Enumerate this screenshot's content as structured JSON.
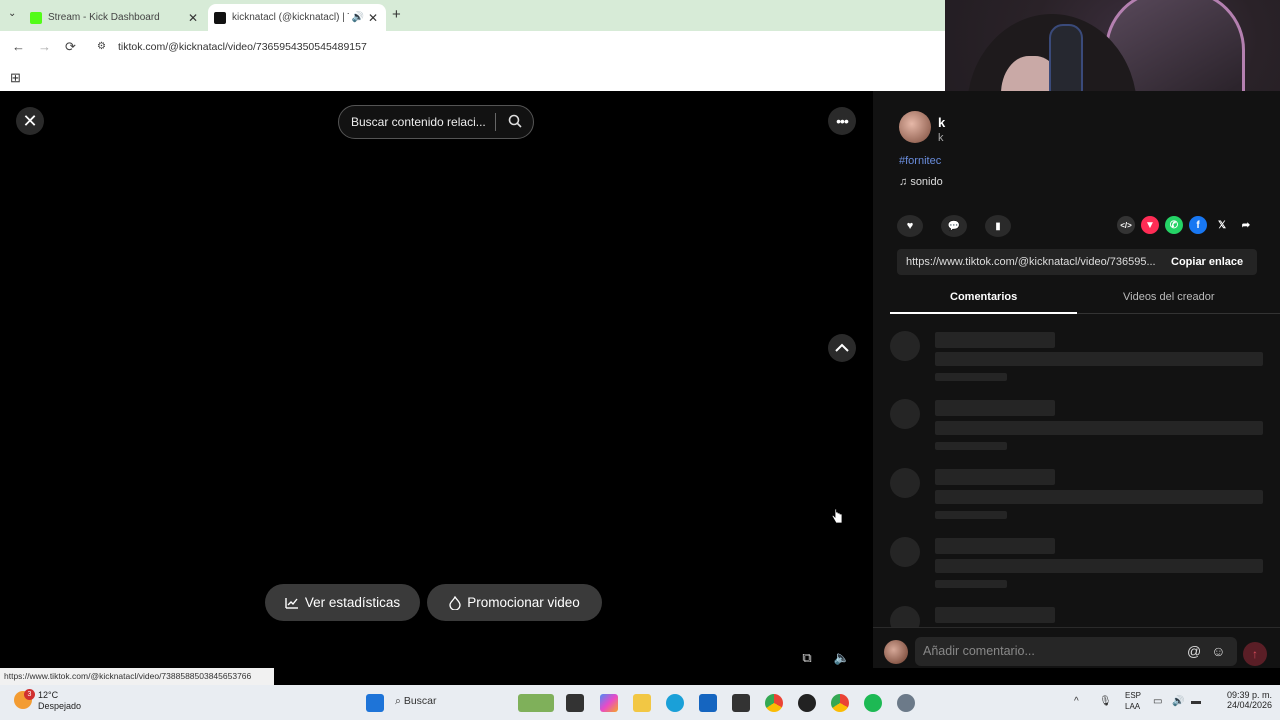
{
  "browser": {
    "tabs": [
      {
        "title": "Stream - Kick Dashboard",
        "favicon_color": "#53fc18"
      },
      {
        "title": "kicknatacl (@kicknatacl) | Ti",
        "favicon_color": "#111111"
      }
    ],
    "url": "tiktok.com/@kicknatacl/video/7365954350545489157"
  },
  "video": {
    "search_placeholder": "Buscar contenido relaci...",
    "stats_button": "Ver estadísticas",
    "promote_button": "Promocionar video",
    "hover_url": "https://www.tiktok.com/@kicknatacl/video/7388588503845653766"
  },
  "panel": {
    "name": "k",
    "username": "k",
    "hashtag": "#fornitec",
    "sound": "sonido",
    "share_link": "https://www.tiktok.com/@kicknatacl/video/736595...",
    "copy_button": "Copiar enlace",
    "tabs": [
      "Comentarios",
      "Videos del creador"
    ],
    "comment_placeholder": "Añadir comentario..."
  },
  "taskbar": {
    "weather_temp": "12°C",
    "weather_desc": "Despejado",
    "weather_badge": "3",
    "search_label": "Buscar",
    "lang_top": "ESP",
    "lang_bottom": "LAA",
    "time": "09:39 p. m.",
    "date": "24/04/2026"
  },
  "colors": {
    "tiktok_red": "#fe2c55",
    "panel_bg": "#121212",
    "tab_bar": "#d7ebd7"
  }
}
